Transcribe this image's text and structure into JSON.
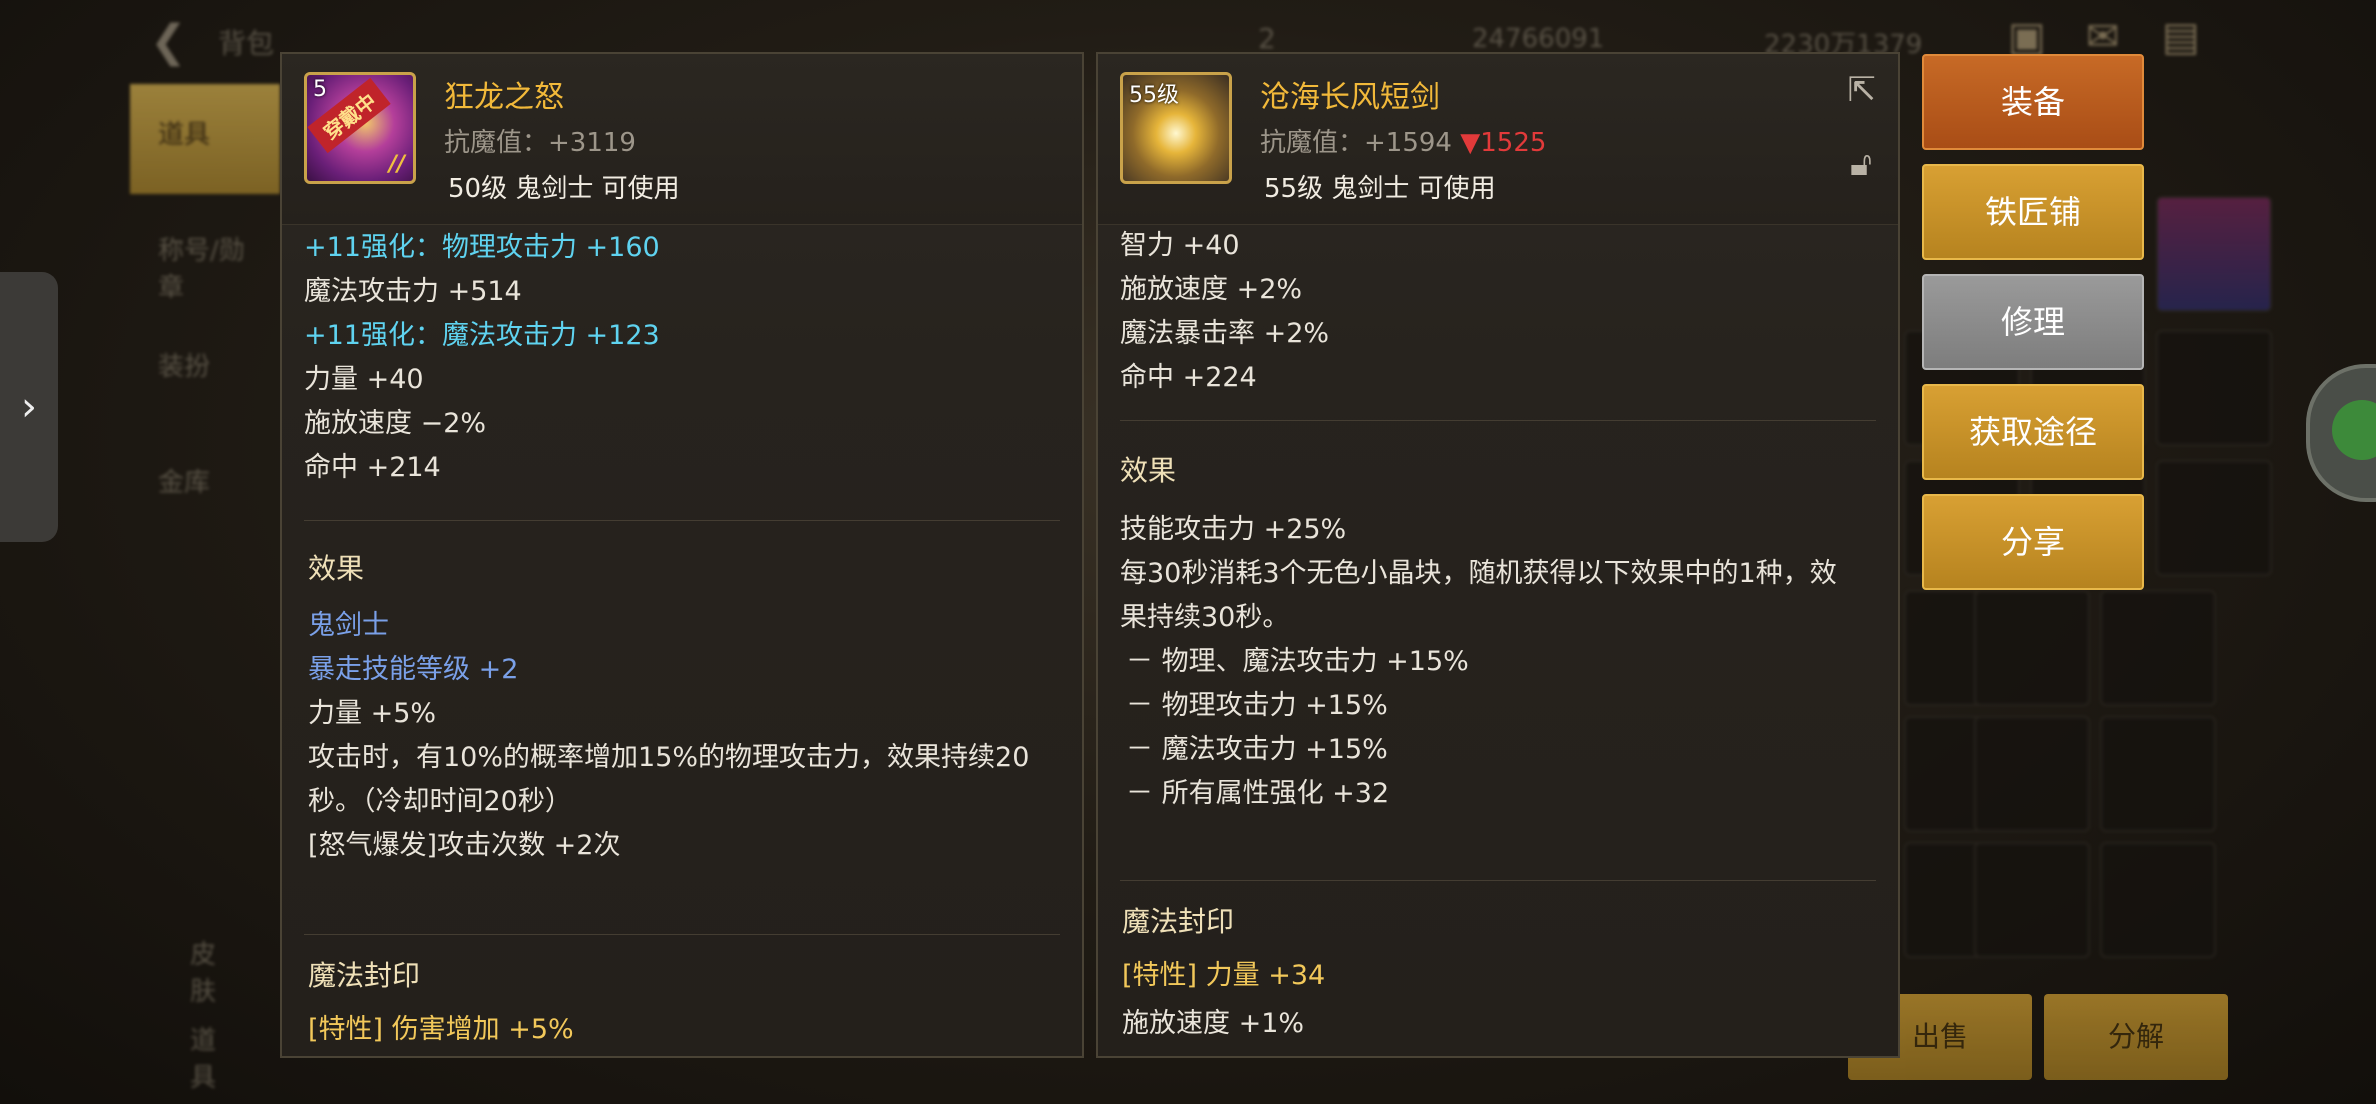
{
  "topbar": {
    "title": "背包",
    "count": "2",
    "gold": "24766091",
    "points": "2230万1379"
  },
  "side_tabs": [
    "道具",
    "称号/勋章",
    "装扮",
    "金库"
  ],
  "side_bottom": [
    "皮肤",
    "道具"
  ],
  "bottom_buttons": {
    "sell": "出售",
    "disassemble": "分解"
  },
  "left": {
    "level_badge": "5",
    "wearing_badge": "穿戴中",
    "name": "狂龙之怒",
    "resist_label": "抗魔值：",
    "resist_value": "+3119",
    "req": "50级 鬼剑士 可使用",
    "stats": [
      {
        "text": "+11强化：物理攻击力 +160",
        "style": "cyan"
      },
      {
        "text": "魔法攻击力 +514",
        "style": "white"
      },
      {
        "text": "+11强化：魔法攻击力 +123",
        "style": "cyan"
      },
      {
        "text": "力量 +40",
        "style": "white"
      },
      {
        "text": "施放速度 −2%",
        "style": "white"
      },
      {
        "text": "命中 +214",
        "style": "white"
      }
    ],
    "effect_title": "效果",
    "effects": [
      {
        "text": "鬼剑士",
        "style": "blue"
      },
      {
        "text": "暴走技能等级 +2",
        "style": "blue"
      },
      {
        "text": "力量 +5%",
        "style": "white"
      },
      {
        "text": "攻击时，有10%的概率增加15%的物理攻击力，效果持续20",
        "style": "white"
      },
      {
        "text": "秒。（冷却时间20秒）",
        "style": "white"
      },
      {
        "text": "[怒气爆发]攻击次数 +2次",
        "style": "white"
      }
    ],
    "seal_title": "魔法封印",
    "seal_line": "[特性] 伤害增加 +5%"
  },
  "right": {
    "level_badge": "55级",
    "name": "沧海长风短剑",
    "resist_label": "抗魔值：",
    "resist_value": "+1594",
    "resist_diff": "▼1525",
    "req": "55级 鬼剑士 可使用",
    "stats": [
      {
        "text": "智力 +40",
        "style": "white"
      },
      {
        "text": "施放速度 +2%",
        "style": "white"
      },
      {
        "text": "魔法暴击率 +2%",
        "style": "white"
      },
      {
        "text": "命中 +224",
        "style": "white"
      }
    ],
    "effect_title": "效果",
    "effects": [
      {
        "text": "技能攻击力 +25%",
        "style": "white"
      },
      {
        "text": "每30秒消耗3个无色小晶块，随机获得以下效果中的1种，效",
        "style": "white"
      },
      {
        "text": "果持续30秒。",
        "style": "white"
      },
      {
        "text": "－ 物理、魔法攻击力 +15%",
        "style": "white"
      },
      {
        "text": "－ 物理攻击力 +15%",
        "style": "white"
      },
      {
        "text": "－ 魔法攻击力 +15%",
        "style": "white"
      },
      {
        "text": "－ 所有属性强化 +32",
        "style": "white"
      }
    ],
    "seal_title": "魔法封印",
    "seal_line": "[特性] 力量 +34",
    "seal_line2": "施放速度 +1%"
  },
  "actions": [
    "装备",
    "铁匠铺",
    "修理",
    "获取途径",
    "分享"
  ]
}
